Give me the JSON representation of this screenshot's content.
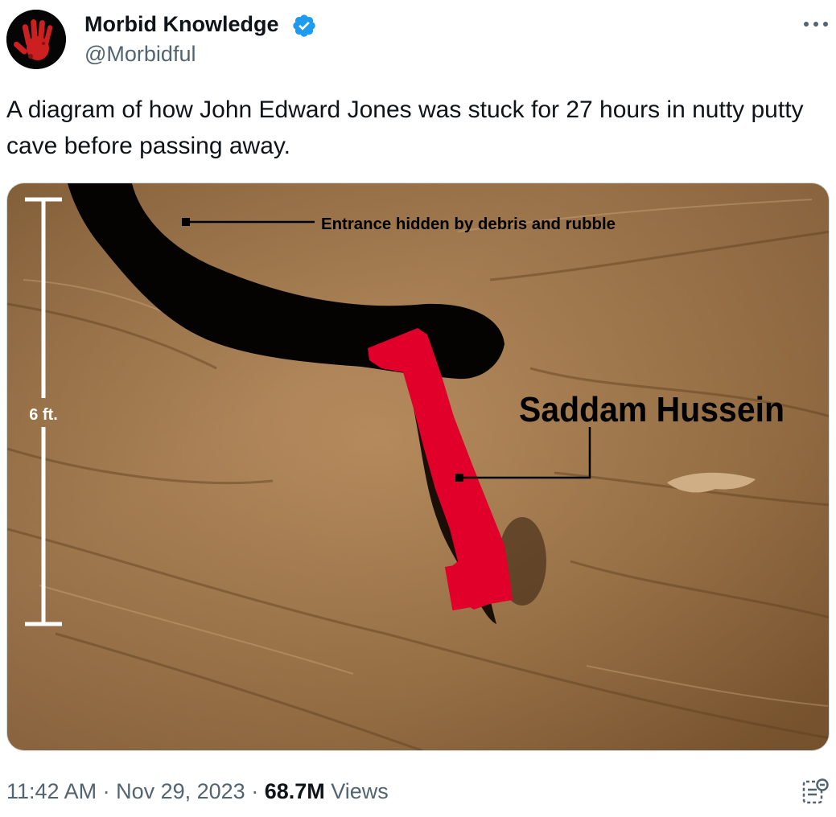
{
  "author": {
    "name": "Morbid Knowledge",
    "handle": "@Morbidful",
    "verified": true,
    "avatar_icon": "red-handprint-icon",
    "avatar_color": "#cc1f1f"
  },
  "tweet": {
    "text": "A diagram of how John Edward Jones was stuck for 27 hours in nutty putty cave before passing away."
  },
  "image": {
    "annotation_entrance": "Entrance hidden by debris and rubble",
    "annotation_figure": "Saddam Hussein",
    "scale_label": "6 ft.",
    "figure_color": "#e0002a"
  },
  "meta": {
    "time": "11:42 AM",
    "separator": " · ",
    "date": "Nov 29, 2023",
    "views_count": "68.7M",
    "views_label": "Views"
  },
  "colors": {
    "text_primary": "#0f1419",
    "text_secondary": "#536471",
    "verified_blue": "#1d9bf0"
  }
}
